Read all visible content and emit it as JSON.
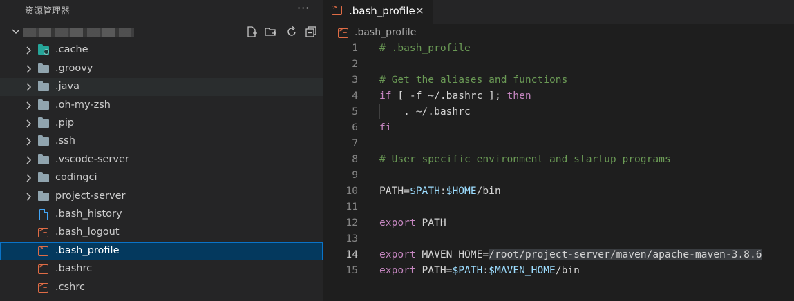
{
  "sidebar": {
    "title": "资源管理器",
    "more": "···",
    "tree": [
      {
        "label": ".cache",
        "type": "folder-special"
      },
      {
        "label": ".groovy",
        "type": "folder"
      },
      {
        "label": ".java",
        "type": "folder",
        "state": "hover"
      },
      {
        "label": ".oh-my-zsh",
        "type": "folder"
      },
      {
        "label": ".pip",
        "type": "folder"
      },
      {
        "label": ".ssh",
        "type": "folder"
      },
      {
        "label": ".vscode-server",
        "type": "folder"
      },
      {
        "label": "codingci",
        "type": "folder"
      },
      {
        "label": "project-server",
        "type": "folder"
      },
      {
        "label": ".bash_history",
        "type": "file"
      },
      {
        "label": ".bash_logout",
        "type": "shell"
      },
      {
        "label": ".bash_profile",
        "type": "shell",
        "state": "selected"
      },
      {
        "label": ".bashrc",
        "type": "shell"
      },
      {
        "label": ".cshrc",
        "type": "shell"
      }
    ]
  },
  "editor": {
    "tab": {
      "label": ".bash_profile",
      "close": "✕"
    },
    "breadcrumb": ".bash_profile",
    "current_line": 14
  },
  "colors": {
    "comment": "#6a9955",
    "keyword": "#c586c0",
    "variable": "#9cdcfe",
    "selection": "#04395e",
    "shell_icon": "#e06c45"
  },
  "icons": [
    "chevron-down-icon",
    "chevron-right-icon",
    "new-file-icon",
    "new-folder-icon",
    "refresh-icon",
    "collapse-all-icon",
    "folder-icon",
    "terminal-file-icon",
    "file-icon",
    "close-icon"
  ]
}
